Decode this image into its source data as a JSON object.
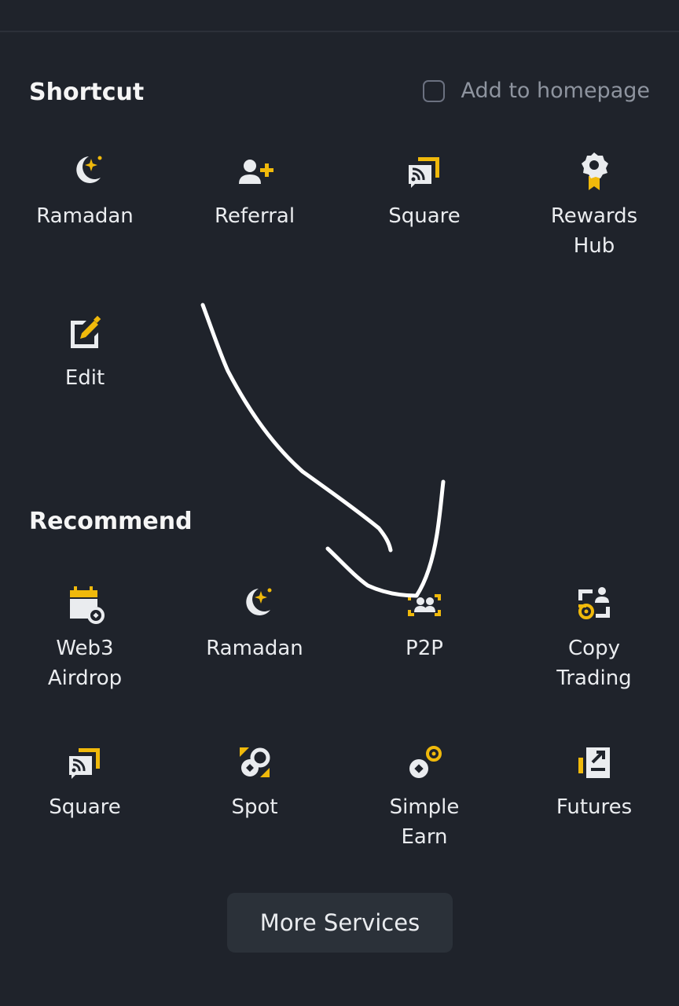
{
  "shortcut": {
    "title": "Shortcut",
    "add_to_homepage_label": "Add to homepage",
    "items": [
      {
        "label": "Ramadan",
        "icon": "crescent-moon-icon"
      },
      {
        "label": "Referral",
        "icon": "add-user-icon"
      },
      {
        "label": "Square",
        "icon": "square-feed-icon"
      },
      {
        "label": "Rewards\nHub",
        "icon": "award-ribbon-icon"
      },
      {
        "label": "Edit",
        "icon": "edit-icon"
      }
    ]
  },
  "recommend": {
    "title": "Recommend",
    "items": [
      {
        "label": "Web3\nAirdrop",
        "icon": "calendar-airdrop-icon"
      },
      {
        "label": "Ramadan",
        "icon": "crescent-moon-icon"
      },
      {
        "label": "P2P",
        "icon": "p2p-users-icon"
      },
      {
        "label": "Copy\nTrading",
        "icon": "copy-trading-icon"
      },
      {
        "label": "Square",
        "icon": "square-feed-icon"
      },
      {
        "label": "Spot",
        "icon": "spot-icon"
      },
      {
        "label": "Simple\nEarn",
        "icon": "simple-earn-icon"
      },
      {
        "label": "Futures",
        "icon": "futures-icon"
      }
    ]
  },
  "more_services_label": "More Services",
  "colors": {
    "background": "#1f232b",
    "accent_yellow": "#f0b90b",
    "icon_gray": "#eaecef",
    "button_bg": "#2b3139"
  }
}
